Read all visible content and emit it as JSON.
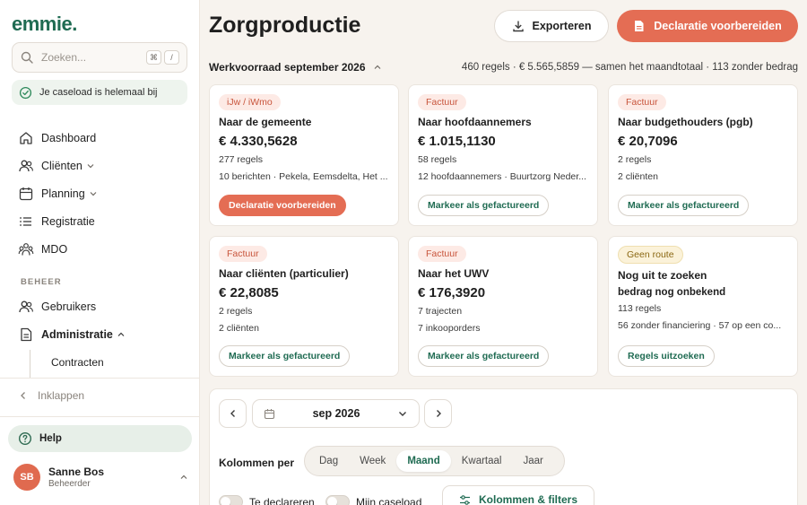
{
  "brand": {
    "logo": "emmie."
  },
  "search": {
    "placeholder": "Zoeken...",
    "kbd1": "⌘",
    "kbd2": "/"
  },
  "caseload": {
    "text": "Je caseload is helemaal bij"
  },
  "nav": {
    "items": [
      {
        "label": "Dashboard",
        "icon": "home-icon"
      },
      {
        "label": "Cliënten",
        "icon": "users-icon"
      },
      {
        "label": "Planning",
        "icon": "calendar-icon"
      },
      {
        "label": "Registratie",
        "icon": "list-icon"
      },
      {
        "label": "MDO",
        "icon": "group-icon"
      }
    ],
    "section": "BEHEER",
    "admin": [
      {
        "label": "Gebruikers",
        "icon": "users-icon"
      },
      {
        "label": "Administratie",
        "icon": "document-icon"
      }
    ],
    "sub": "Contracten",
    "collapse": "Inklappen"
  },
  "help": {
    "label": "Help"
  },
  "user": {
    "initials": "SB",
    "name": "Sanne Bos",
    "role": "Beheerder"
  },
  "header": {
    "title": "Zorgproductie",
    "export_label": "Exporteren",
    "primary_label": "Declaratie voorbereiden"
  },
  "subheader": {
    "title": "Werkvoorraad september 2026",
    "summary": "460 regels · € 5.565,5859 — samen het maandtotaal · 113 zonder bedrag"
  },
  "cards": [
    {
      "badge": "iJw / iWmo",
      "title": "Naar de gemeente",
      "amount": "€ 4.330,5628",
      "line1": "277 regels",
      "line2": "10 berichten · Pekela, Eemsdelta, Het ...",
      "button": "Declaratie voorbereiden"
    },
    {
      "badge": "Factuur",
      "title": "Naar hoofdaannemers",
      "amount": "€ 1.015,1130",
      "line1": "58 regels",
      "line2": "12 hoofdaannemers · Buurtzorg Neder...",
      "button": "Markeer als gefactureerd"
    },
    {
      "badge": "Factuur",
      "title": "Naar budgethouders (pgb)",
      "amount": "€ 20,7096",
      "line1": "2 regels",
      "line2": "2 cliënten",
      "button": "Markeer als gefactureerd"
    },
    {
      "badge": "Factuur",
      "title": "Naar cliënten (particulier)",
      "amount": "€ 22,8085",
      "line1": "2 regels",
      "line2": "2 cliënten",
      "button": "Markeer als gefactureerd"
    },
    {
      "badge": "Factuur",
      "title": "Naar het UWV",
      "amount": "€ 176,3920",
      "line1": "7 trajecten",
      "line2": "7 inkooporders",
      "button": "Markeer als gefactureerd"
    },
    {
      "badge": "Geen route",
      "title": "Nog uit te zoeken",
      "amount": "bedrag nog onbekend",
      "line1": "113 regels",
      "line2": "56 zonder financiering · 57 op een co...",
      "button": "Regels uitzoeken"
    }
  ],
  "filters": {
    "month": "sep 2026",
    "columns_label": "Kolommen per",
    "segments": [
      "Dag",
      "Week",
      "Maand",
      "Kwartaal",
      "Jaar"
    ],
    "active_segment": "Maand",
    "toggle1": "Te declareren",
    "toggle2": "Mijn caseload",
    "filters_button": "Kolommen & filters"
  },
  "colors": {
    "primary": "#e46d54",
    "brand": "#1f6b52",
    "background": "#f7f3ee"
  }
}
